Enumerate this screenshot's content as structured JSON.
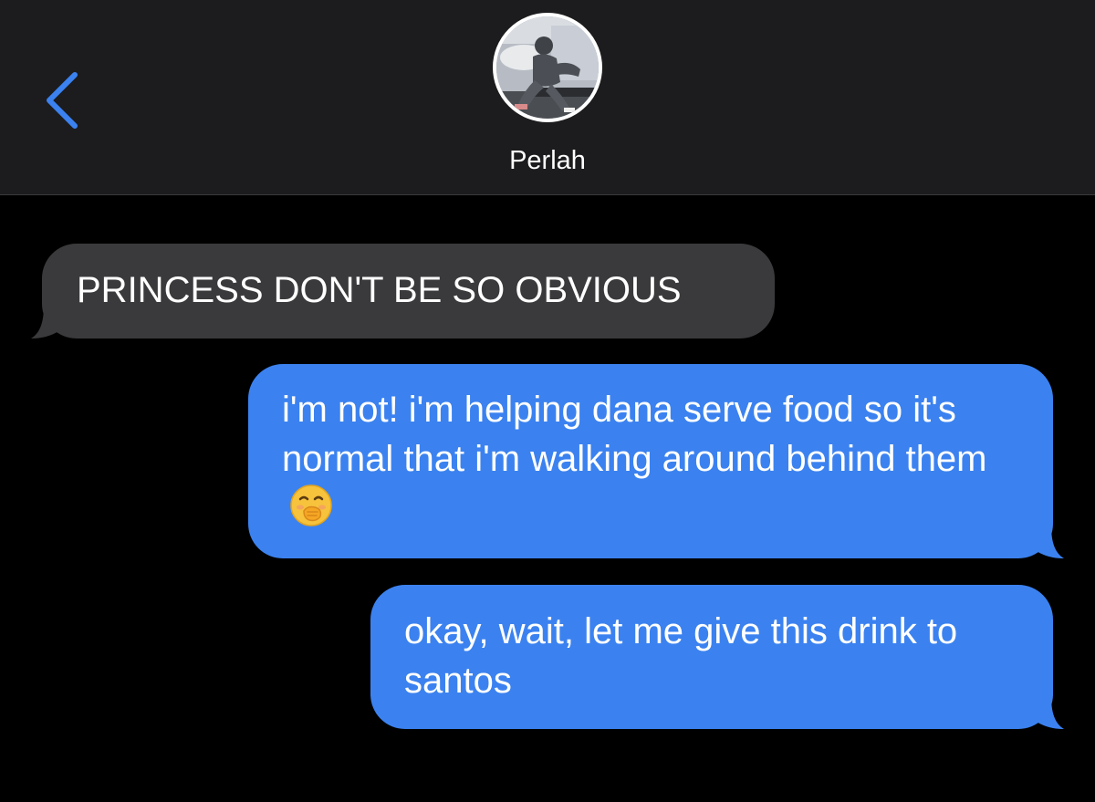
{
  "header": {
    "back_icon": "chevron-left-icon",
    "contact_name": "Perlah",
    "avatar_icon": "contact-photo",
    "accent_color": "#3b82f0"
  },
  "messages": [
    {
      "direction": "received",
      "text": "PRINCESS DON'T BE SO OBVIOUS"
    },
    {
      "direction": "sent",
      "text": "i'm not! i'm helping dana serve food so it's normal that i'm walking around behind them",
      "emoji": "face-with-hand-over-mouth-icon"
    },
    {
      "direction": "sent",
      "text": "okay, wait, let me give this drink to santos"
    }
  ],
  "colors": {
    "header_bg": "#1c1c1e",
    "received_bubble": "#3a3a3c",
    "sent_bubble": "#3b82f0",
    "background": "#000000"
  }
}
